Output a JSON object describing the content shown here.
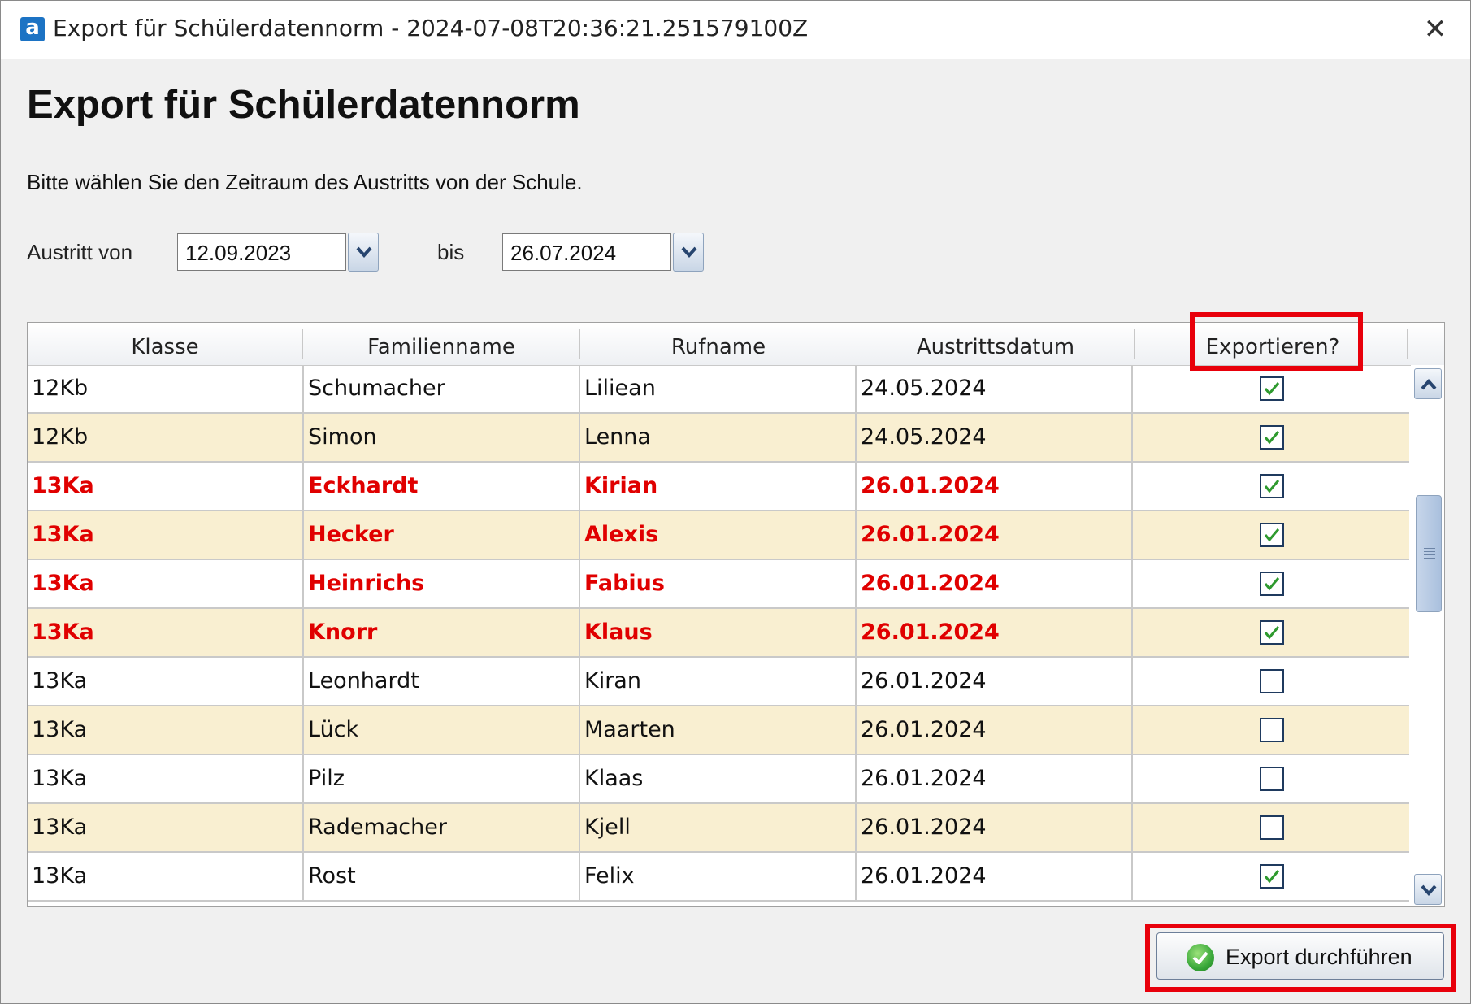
{
  "window": {
    "title": "Export für Schülerdatennorm - 2024-07-08T20:36:21.251579100Z",
    "app_icon_letter": "a",
    "close_symbol": "✕"
  },
  "page": {
    "heading": "Export für Schülerdatennorm",
    "instruction": "Bitte wählen Sie den Zeitraum des Austritts von der Schule."
  },
  "filter": {
    "from_label": "Austritt von",
    "from_value": "12.09.2023",
    "to_label": "bis",
    "to_value": "26.07.2024"
  },
  "table": {
    "columns": [
      "Klasse",
      "Familienname",
      "Rufname",
      "Austrittsdatum",
      "Exportieren?"
    ],
    "rows": [
      {
        "klasse": "12Kb",
        "familienname": "Schumacher",
        "rufname": "Liliean",
        "austrittsdatum": "24.05.2024",
        "exportieren": true,
        "highlight": false
      },
      {
        "klasse": "12Kb",
        "familienname": "Simon",
        "rufname": "Lenna",
        "austrittsdatum": "24.05.2024",
        "exportieren": true,
        "highlight": false
      },
      {
        "klasse": "13Ka",
        "familienname": "Eckhardt",
        "rufname": "Kirian",
        "austrittsdatum": "26.01.2024",
        "exportieren": true,
        "highlight": true
      },
      {
        "klasse": "13Ka",
        "familienname": "Hecker",
        "rufname": "Alexis",
        "austrittsdatum": "26.01.2024",
        "exportieren": true,
        "highlight": true
      },
      {
        "klasse": "13Ka",
        "familienname": "Heinrichs",
        "rufname": "Fabius",
        "austrittsdatum": "26.01.2024",
        "exportieren": true,
        "highlight": true
      },
      {
        "klasse": "13Ka",
        "familienname": "Knorr",
        "rufname": "Klaus",
        "austrittsdatum": "26.01.2024",
        "exportieren": true,
        "highlight": true
      },
      {
        "klasse": "13Ka",
        "familienname": "Leonhardt",
        "rufname": "Kiran",
        "austrittsdatum": "26.01.2024",
        "exportieren": false,
        "highlight": false
      },
      {
        "klasse": "13Ka",
        "familienname": "Lück",
        "rufname": "Maarten",
        "austrittsdatum": "26.01.2024",
        "exportieren": false,
        "highlight": false
      },
      {
        "klasse": "13Ka",
        "familienname": "Pilz",
        "rufname": "Klaas",
        "austrittsdatum": "26.01.2024",
        "exportieren": false,
        "highlight": false
      },
      {
        "klasse": "13Ka",
        "familienname": "Rademacher",
        "rufname": "Kjell",
        "austrittsdatum": "26.01.2024",
        "exportieren": false,
        "highlight": false
      },
      {
        "klasse": "13Ka",
        "familienname": "Rost",
        "rufname": "Felix",
        "austrittsdatum": "26.01.2024",
        "exportieren": true,
        "highlight": false
      }
    ]
  },
  "actions": {
    "export_label": "Export durchführen"
  },
  "colors": {
    "row_alt": "#f9efd1",
    "highlight_text": "#e00000",
    "annotation_box": "#e8000b",
    "checkmark": "#2e9a2e"
  }
}
